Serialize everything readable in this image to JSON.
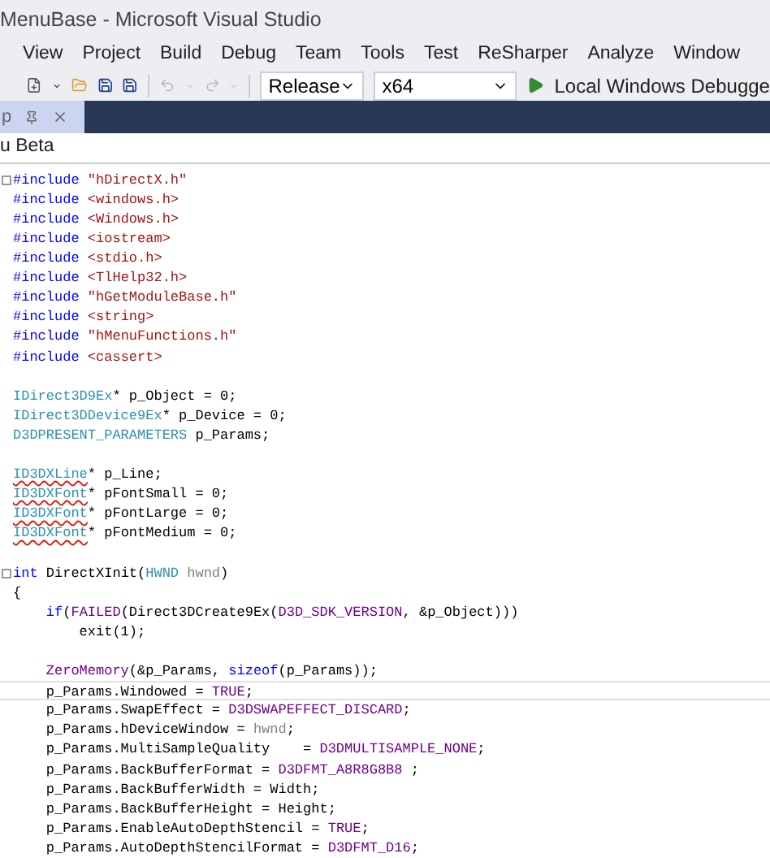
{
  "window": {
    "title": "MenuBase - Microsoft Visual Studio"
  },
  "menu": [
    "View",
    "Project",
    "Build",
    "Debug",
    "Team",
    "Tools",
    "Test",
    "ReSharper",
    "Analyze",
    "Window"
  ],
  "toolbar": {
    "configuration": "Release",
    "platform": "x64",
    "run_label": "Local Windows Debugge"
  },
  "doc_tab": {
    "label": "p"
  },
  "breadcrumb": "u Beta",
  "code": [
    {
      "kind": "code",
      "fold": true,
      "tokens": [
        {
          "t": "#include",
          "kind": "kw"
        },
        {
          "t": " \"hDirectX.h\"",
          "kind": "str"
        }
      ]
    },
    {
      "kind": "code",
      "tokens": [
        {
          "t": "#include",
          "kind": "kw"
        },
        {
          "t": " <windows.h>",
          "kind": "str"
        }
      ]
    },
    {
      "kind": "code",
      "tokens": [
        {
          "t": "#include",
          "kind": "kw"
        },
        {
          "t": " <Windows.h>",
          "kind": "str"
        }
      ]
    },
    {
      "kind": "code",
      "tokens": [
        {
          "t": "#include",
          "kind": "kw"
        },
        {
          "t": " <iostream>",
          "kind": "str"
        }
      ]
    },
    {
      "kind": "code",
      "tokens": [
        {
          "t": "#include",
          "kind": "kw"
        },
        {
          "t": " <stdio.h>",
          "kind": "str"
        }
      ]
    },
    {
      "kind": "code",
      "tokens": [
        {
          "t": "#include",
          "kind": "kw"
        },
        {
          "t": " <TlHelp32.h>",
          "kind": "str"
        }
      ]
    },
    {
      "kind": "code",
      "tokens": [
        {
          "t": "#include",
          "kind": "kw"
        },
        {
          "t": " \"hGetModuleBase.h\"",
          "kind": "str"
        }
      ]
    },
    {
      "kind": "code",
      "tokens": [
        {
          "t": "#include",
          "kind": "kw"
        },
        {
          "t": " <string>",
          "kind": "str"
        }
      ]
    },
    {
      "kind": "code",
      "tokens": [
        {
          "t": "#include",
          "kind": "kw"
        },
        {
          "t": " \"hMenuFunctions.h\"",
          "kind": "str"
        }
      ]
    },
    {
      "kind": "code",
      "tokens": [
        {
          "t": "#include",
          "kind": "kw"
        },
        {
          "t": " <cassert>",
          "kind": "str"
        }
      ]
    },
    {
      "kind": "blank"
    },
    {
      "kind": "code",
      "tokens": [
        {
          "t": "IDirect3D9Ex",
          "kind": "type"
        },
        {
          "t": "* p_Object = 0;",
          "kind": "plain"
        }
      ]
    },
    {
      "kind": "code",
      "tokens": [
        {
          "t": "IDirect3DDevice9Ex",
          "kind": "type"
        },
        {
          "t": "* p_Device = 0;",
          "kind": "plain"
        }
      ]
    },
    {
      "kind": "code",
      "tokens": [
        {
          "t": "D3DPRESENT_PARAMETERS",
          "kind": "type"
        },
        {
          "t": " p_Params;",
          "kind": "plain"
        }
      ]
    },
    {
      "kind": "blank"
    },
    {
      "kind": "code",
      "tokens": [
        {
          "t": "ID3DXLine",
          "kind": "error"
        },
        {
          "t": "* p_Line;",
          "kind": "plain"
        }
      ]
    },
    {
      "kind": "code",
      "tokens": [
        {
          "t": "ID3DXFont",
          "kind": "error"
        },
        {
          "t": "* pFontSmall = 0;",
          "kind": "plain"
        }
      ]
    },
    {
      "kind": "code",
      "tokens": [
        {
          "t": "ID3DXFont",
          "kind": "error"
        },
        {
          "t": "* pFontLarge = 0;",
          "kind": "plain"
        }
      ]
    },
    {
      "kind": "code",
      "tokens": [
        {
          "t": "ID3DXFont",
          "kind": "error"
        },
        {
          "t": "* pFontMedium = 0;",
          "kind": "plain"
        }
      ]
    },
    {
      "kind": "blank"
    },
    {
      "kind": "code",
      "fold": true,
      "tokens": [
        {
          "t": "int",
          "kind": "kw"
        },
        {
          "t": " DirectXInit(",
          "kind": "plain"
        },
        {
          "t": "HWND",
          "kind": "type"
        },
        {
          "t": " hwnd",
          "kind": "param"
        },
        {
          "t": ")",
          "kind": "plain"
        }
      ]
    },
    {
      "kind": "code",
      "tokens": [
        {
          "t": "{",
          "kind": "plain"
        }
      ]
    },
    {
      "kind": "code",
      "tokens": [
        {
          "t": "    if",
          "kind": "kw"
        },
        {
          "t": "(",
          "kind": "plain"
        },
        {
          "t": "FAILED",
          "kind": "macro"
        },
        {
          "t": "(Direct3DCreate9Ex(",
          "kind": "plain"
        },
        {
          "t": "D3D_SDK_VERSION",
          "kind": "macro"
        },
        {
          "t": ", &p_Object)))",
          "kind": "plain"
        }
      ]
    },
    {
      "kind": "code",
      "tokens": [
        {
          "t": "        exit(1);",
          "kind": "plain"
        }
      ]
    },
    {
      "kind": "blank"
    },
    {
      "kind": "code",
      "tokens": [
        {
          "t": "    ZeroMemory",
          "kind": "macro"
        },
        {
          "t": "(&p_Params, ",
          "kind": "plain"
        },
        {
          "t": "sizeof",
          "kind": "kw"
        },
        {
          "t": "(p_Params));",
          "kind": "plain"
        }
      ]
    },
    {
      "kind": "code",
      "current": true,
      "tokens": [
        {
          "t": "    p_Params.Windowed = ",
          "kind": "plain"
        },
        {
          "t": "TRUE",
          "kind": "macro"
        },
        {
          "t": ";",
          "kind": "plain"
        }
      ]
    },
    {
      "kind": "code",
      "tokens": [
        {
          "t": "    p_Params.SwapEffect = ",
          "kind": "plain"
        },
        {
          "t": "D3DSWAPEFFECT_DISCARD",
          "kind": "macro"
        },
        {
          "t": ";",
          "kind": "plain"
        }
      ]
    },
    {
      "kind": "code",
      "tokens": [
        {
          "t": "    p_Params.hDeviceWindow = ",
          "kind": "plain"
        },
        {
          "t": "hwnd",
          "kind": "param"
        },
        {
          "t": ";",
          "kind": "plain"
        }
      ]
    },
    {
      "kind": "code",
      "tokens": [
        {
          "t": "    p_Params.MultiSampleQuality    = ",
          "kind": "plain"
        },
        {
          "t": "D3DMULTISAMPLE_NONE",
          "kind": "macro"
        },
        {
          "t": ";",
          "kind": "plain"
        }
      ]
    },
    {
      "kind": "code",
      "tokens": [
        {
          "t": "    p_Params.BackBufferFormat = ",
          "kind": "plain"
        },
        {
          "t": "D3DFMT_A8R8G8B8",
          "kind": "macro"
        },
        {
          "t": " ;",
          "kind": "plain"
        }
      ]
    },
    {
      "kind": "code",
      "tokens": [
        {
          "t": "    p_Params.BackBufferWidth = Width;",
          "kind": "plain"
        }
      ]
    },
    {
      "kind": "code",
      "tokens": [
        {
          "t": "    p_Params.BackBufferHeight = Height;",
          "kind": "plain"
        }
      ]
    },
    {
      "kind": "code",
      "tokens": [
        {
          "t": "    p_Params.EnableAutoDepthStencil = ",
          "kind": "plain"
        },
        {
          "t": "TRUE",
          "kind": "macro"
        },
        {
          "t": ";",
          "kind": "plain"
        }
      ]
    },
    {
      "kind": "code",
      "tokens": [
        {
          "t": "    p_Params.AutoDepthStencilFormat = ",
          "kind": "plain"
        },
        {
          "t": "D3DFMT_D16",
          "kind": "macro"
        },
        {
          "t": ";",
          "kind": "plain"
        }
      ]
    }
  ]
}
